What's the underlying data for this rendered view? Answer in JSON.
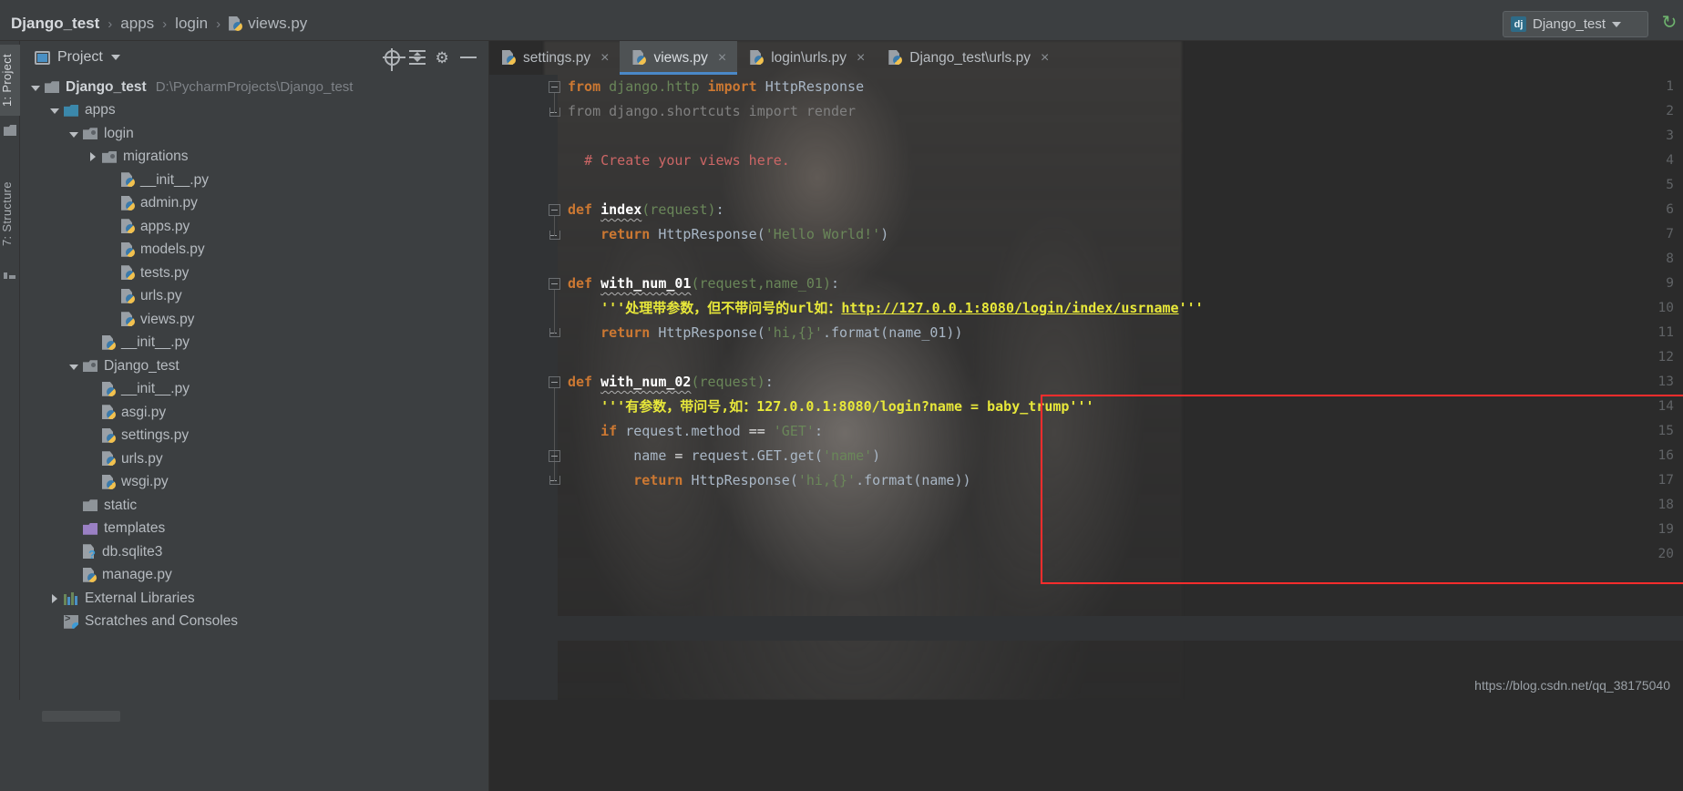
{
  "breadcrumb": {
    "items": [
      {
        "label": "Django_test",
        "icon": "none",
        "bold": true
      },
      {
        "label": "apps",
        "icon": "none",
        "bold": false
      },
      {
        "label": "login",
        "icon": "none",
        "bold": false
      },
      {
        "label": "views.py",
        "icon": "python-file-icon",
        "bold": false
      }
    ],
    "separator": "›"
  },
  "run_config": {
    "badge": "dj",
    "name": "Django_test",
    "dropdown_icon": "chevron-down-icon",
    "refresh_icon": "refresh-icon"
  },
  "tool_tabs": {
    "project": "1: Project",
    "structure": "7: Structure"
  },
  "project_panel": {
    "title": "Project",
    "title_icon": "window-icon",
    "dropdown_icon": "chevron-down-icon",
    "buttons": [
      {
        "name": "locate-target-icon",
        "label": ""
      },
      {
        "name": "collapse-all-icon",
        "label": ""
      },
      {
        "name": "gear-icon",
        "label": "⚙"
      },
      {
        "name": "hide-panel-icon",
        "label": ""
      }
    ],
    "tree": [
      {
        "label": "Django_test",
        "path": "D:\\PycharmProjects\\Django_test",
        "indent": 0,
        "twist": "down",
        "icon": "folder",
        "bold": true
      },
      {
        "label": "apps",
        "path": "",
        "indent": 1,
        "twist": "down",
        "icon": "folder-blue",
        "bold": false
      },
      {
        "label": "login",
        "path": "",
        "indent": 2,
        "twist": "down",
        "icon": "folder-module",
        "bold": false
      },
      {
        "label": "migrations",
        "path": "",
        "indent": 3,
        "twist": "right",
        "icon": "folder-module",
        "bold": false
      },
      {
        "label": "__init__.py",
        "path": "",
        "indent": 4,
        "twist": "none",
        "icon": "python",
        "bold": false
      },
      {
        "label": "admin.py",
        "path": "",
        "indent": 4,
        "twist": "none",
        "icon": "python",
        "bold": false
      },
      {
        "label": "apps.py",
        "path": "",
        "indent": 4,
        "twist": "none",
        "icon": "python",
        "bold": false
      },
      {
        "label": "models.py",
        "path": "",
        "indent": 4,
        "twist": "none",
        "icon": "python",
        "bold": false
      },
      {
        "label": "tests.py",
        "path": "",
        "indent": 4,
        "twist": "none",
        "icon": "python",
        "bold": false
      },
      {
        "label": "urls.py",
        "path": "",
        "indent": 4,
        "twist": "none",
        "icon": "python",
        "bold": false
      },
      {
        "label": "views.py",
        "path": "",
        "indent": 4,
        "twist": "none",
        "icon": "python",
        "bold": false
      },
      {
        "label": "__init__.py",
        "path": "",
        "indent": 3,
        "twist": "none",
        "icon": "python",
        "bold": false
      },
      {
        "label": "Django_test",
        "path": "",
        "indent": 2,
        "twist": "down",
        "icon": "folder-module",
        "bold": false
      },
      {
        "label": "__init__.py",
        "path": "",
        "indent": 3,
        "twist": "none",
        "icon": "python",
        "bold": false
      },
      {
        "label": "asgi.py",
        "path": "",
        "indent": 3,
        "twist": "none",
        "icon": "python",
        "bold": false
      },
      {
        "label": "settings.py",
        "path": "",
        "indent": 3,
        "twist": "none",
        "icon": "python",
        "bold": false
      },
      {
        "label": "urls.py",
        "path": "",
        "indent": 3,
        "twist": "none",
        "icon": "python",
        "bold": false
      },
      {
        "label": "wsgi.py",
        "path": "",
        "indent": 3,
        "twist": "none",
        "icon": "python",
        "bold": false
      },
      {
        "label": "static",
        "path": "",
        "indent": 2,
        "twist": "none",
        "icon": "folder",
        "bold": false
      },
      {
        "label": "templates",
        "path": "",
        "indent": 2,
        "twist": "none",
        "icon": "folder-purple",
        "bold": false
      },
      {
        "label": "db.sqlite3",
        "path": "",
        "indent": 2,
        "twist": "none",
        "icon": "unknown-file",
        "bold": false
      },
      {
        "label": "manage.py",
        "path": "",
        "indent": 2,
        "twist": "none",
        "icon": "python",
        "bold": false
      },
      {
        "label": "External Libraries",
        "path": "",
        "indent": 1,
        "twist": "right",
        "icon": "library",
        "bold": false
      },
      {
        "label": "Scratches and Consoles",
        "path": "",
        "indent": 1,
        "twist": "none",
        "icon": "scratch",
        "bold": false
      }
    ]
  },
  "editor_tabs": [
    {
      "label": "settings.py",
      "icon": "python-file-icon",
      "active": false,
      "close": "×"
    },
    {
      "label": "views.py",
      "icon": "python-file-icon",
      "active": true,
      "close": "×"
    },
    {
      "label": "login\\urls.py",
      "icon": "python-file-icon",
      "active": false,
      "close": "×"
    },
    {
      "label": "Django_test\\urls.py",
      "icon": "python-file-icon",
      "active": false,
      "close": "×"
    }
  ],
  "code": {
    "line_numbers": [
      1,
      2,
      3,
      4,
      5,
      6,
      7,
      8,
      9,
      10,
      11,
      12,
      13,
      14,
      15,
      16,
      17,
      18,
      19,
      20
    ],
    "lines": [
      "from django.http import HttpResponse",
      "from django.shortcuts import render",
      "",
      "# Create your views here.",
      "",
      "def index(request):",
      "    return HttpResponse('Hello World!')",
      "",
      "def with_num_01(request,name_01):",
      "    '''处理带参数，但不带问号的url如：http://127.0.0.1:8080/login/index/usrname'''",
      "    return HttpResponse('hi,{}'.format(name_01))",
      "",
      "def with_num_02(request):",
      "    '''有参数，带问号,如：127.0.0.1:8080/login?name = baby_trump'''",
      "    if request.method == 'GET':",
      "        name = request.GET.get('name')",
      "        return HttpResponse('hi,{}'.format(name))",
      "",
      "",
      ""
    ]
  },
  "annotation": {
    "highlight_box_color": "#ff2d2d",
    "highlight_lines": "13-19"
  },
  "watermark": "https://blog.csdn.net/qq_38175040"
}
